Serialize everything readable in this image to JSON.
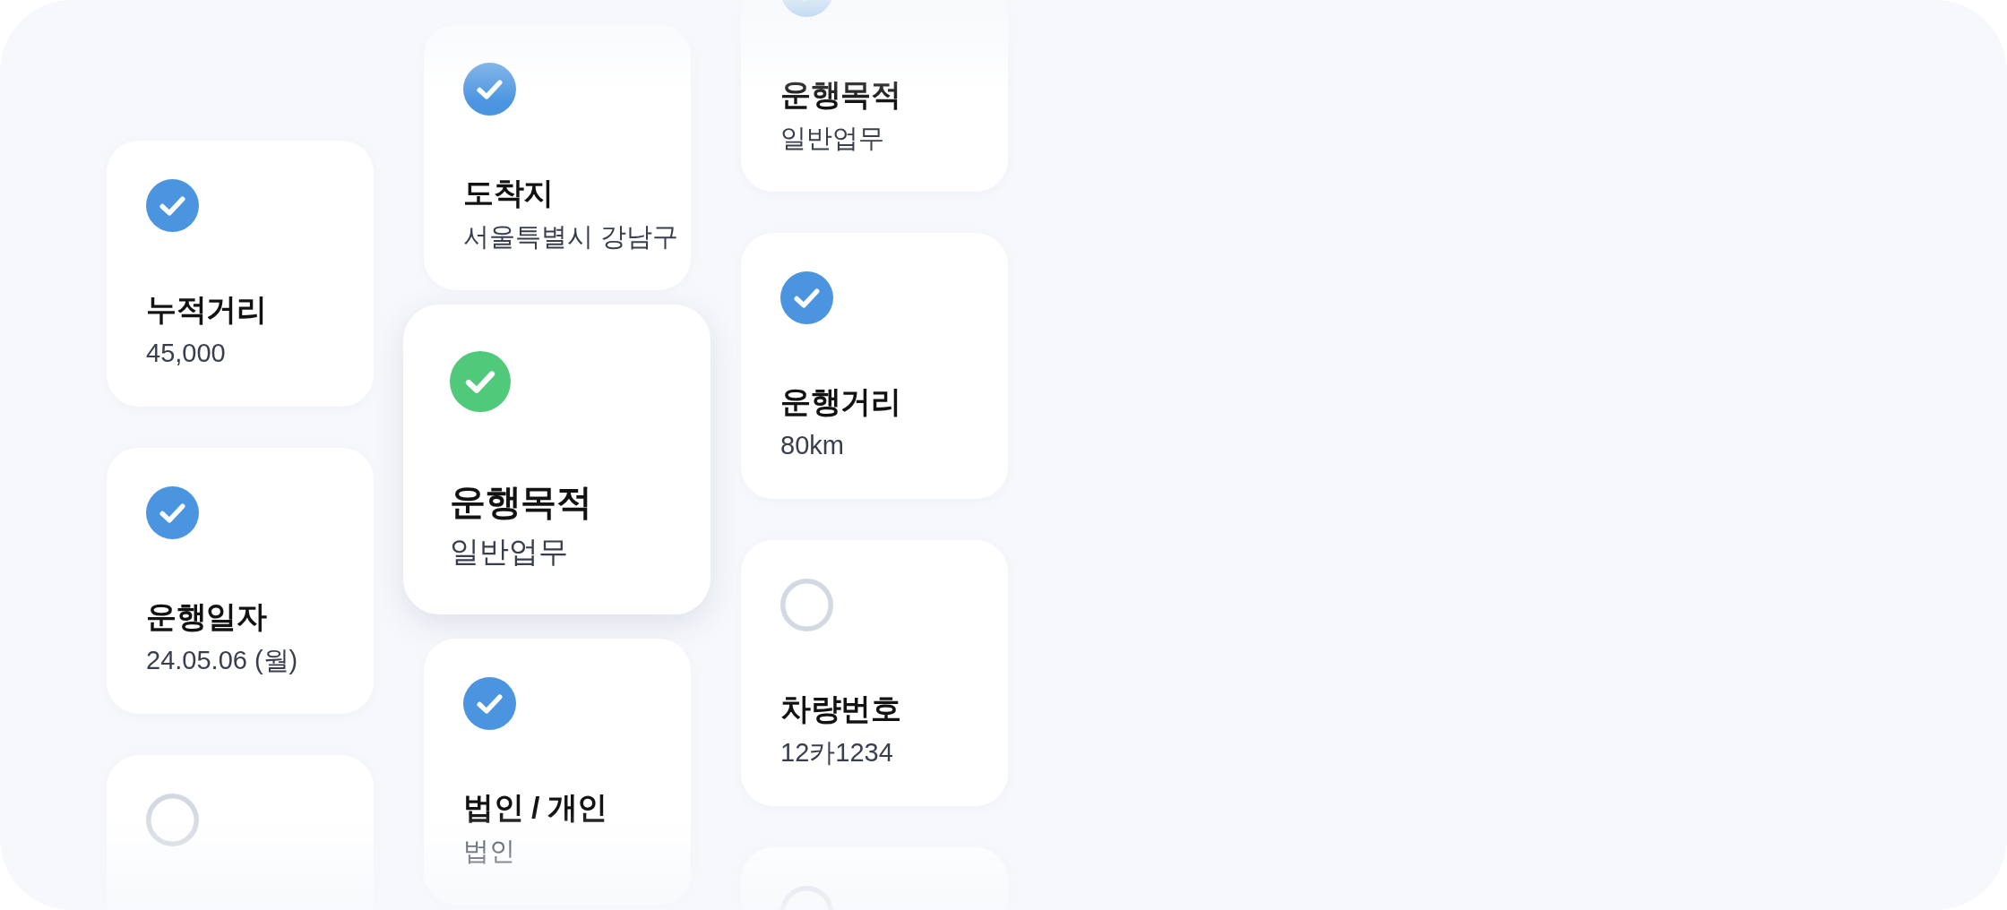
{
  "columns": [
    {
      "cards": [
        {
          "title": "누적거리",
          "value": "45,000",
          "checked": true,
          "selected": false
        },
        {
          "title": "운행일자",
          "value": "24.05.06 (월)",
          "checked": true,
          "selected": false
        },
        {
          "checked": false,
          "selected": false
        }
      ]
    },
    {
      "cards": [
        {
          "title": "도착지",
          "value": "서울특별시 강남구",
          "checked": true,
          "selected": false
        },
        {
          "title": "운행목적",
          "value": "일반업무",
          "checked": true,
          "selected": true
        },
        {
          "title": "법인 / 개인",
          "value": "법인",
          "checked": true,
          "selected": false
        }
      ]
    },
    {
      "cards": [
        {
          "title": "운행목적",
          "value": "일반업무",
          "checked": true,
          "selected": false
        },
        {
          "title": "운행거리",
          "value": "80km",
          "checked": true,
          "selected": false
        },
        {
          "title": "차량번호",
          "value": "12카1234",
          "checked": false,
          "selected": false
        },
        {
          "checked": false,
          "selected": false
        }
      ]
    }
  ]
}
